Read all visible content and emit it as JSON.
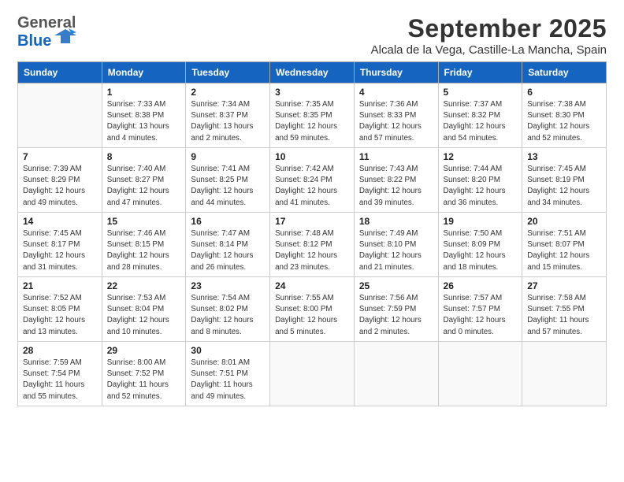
{
  "header": {
    "logo_line1": "General",
    "logo_line2": "Blue",
    "month": "September 2025",
    "location": "Alcala de la Vega, Castille-La Mancha, Spain"
  },
  "days_of_week": [
    "Sunday",
    "Monday",
    "Tuesday",
    "Wednesday",
    "Thursday",
    "Friday",
    "Saturday"
  ],
  "weeks": [
    [
      {
        "day": "",
        "info": ""
      },
      {
        "day": "1",
        "info": "Sunrise: 7:33 AM\nSunset: 8:38 PM\nDaylight: 13 hours\nand 4 minutes."
      },
      {
        "day": "2",
        "info": "Sunrise: 7:34 AM\nSunset: 8:37 PM\nDaylight: 13 hours\nand 2 minutes."
      },
      {
        "day": "3",
        "info": "Sunrise: 7:35 AM\nSunset: 8:35 PM\nDaylight: 12 hours\nand 59 minutes."
      },
      {
        "day": "4",
        "info": "Sunrise: 7:36 AM\nSunset: 8:33 PM\nDaylight: 12 hours\nand 57 minutes."
      },
      {
        "day": "5",
        "info": "Sunrise: 7:37 AM\nSunset: 8:32 PM\nDaylight: 12 hours\nand 54 minutes."
      },
      {
        "day": "6",
        "info": "Sunrise: 7:38 AM\nSunset: 8:30 PM\nDaylight: 12 hours\nand 52 minutes."
      }
    ],
    [
      {
        "day": "7",
        "info": "Sunrise: 7:39 AM\nSunset: 8:29 PM\nDaylight: 12 hours\nand 49 minutes."
      },
      {
        "day": "8",
        "info": "Sunrise: 7:40 AM\nSunset: 8:27 PM\nDaylight: 12 hours\nand 47 minutes."
      },
      {
        "day": "9",
        "info": "Sunrise: 7:41 AM\nSunset: 8:25 PM\nDaylight: 12 hours\nand 44 minutes."
      },
      {
        "day": "10",
        "info": "Sunrise: 7:42 AM\nSunset: 8:24 PM\nDaylight: 12 hours\nand 41 minutes."
      },
      {
        "day": "11",
        "info": "Sunrise: 7:43 AM\nSunset: 8:22 PM\nDaylight: 12 hours\nand 39 minutes."
      },
      {
        "day": "12",
        "info": "Sunrise: 7:44 AM\nSunset: 8:20 PM\nDaylight: 12 hours\nand 36 minutes."
      },
      {
        "day": "13",
        "info": "Sunrise: 7:45 AM\nSunset: 8:19 PM\nDaylight: 12 hours\nand 34 minutes."
      }
    ],
    [
      {
        "day": "14",
        "info": "Sunrise: 7:45 AM\nSunset: 8:17 PM\nDaylight: 12 hours\nand 31 minutes."
      },
      {
        "day": "15",
        "info": "Sunrise: 7:46 AM\nSunset: 8:15 PM\nDaylight: 12 hours\nand 28 minutes."
      },
      {
        "day": "16",
        "info": "Sunrise: 7:47 AM\nSunset: 8:14 PM\nDaylight: 12 hours\nand 26 minutes."
      },
      {
        "day": "17",
        "info": "Sunrise: 7:48 AM\nSunset: 8:12 PM\nDaylight: 12 hours\nand 23 minutes."
      },
      {
        "day": "18",
        "info": "Sunrise: 7:49 AM\nSunset: 8:10 PM\nDaylight: 12 hours\nand 21 minutes."
      },
      {
        "day": "19",
        "info": "Sunrise: 7:50 AM\nSunset: 8:09 PM\nDaylight: 12 hours\nand 18 minutes."
      },
      {
        "day": "20",
        "info": "Sunrise: 7:51 AM\nSunset: 8:07 PM\nDaylight: 12 hours\nand 15 minutes."
      }
    ],
    [
      {
        "day": "21",
        "info": "Sunrise: 7:52 AM\nSunset: 8:05 PM\nDaylight: 12 hours\nand 13 minutes."
      },
      {
        "day": "22",
        "info": "Sunrise: 7:53 AM\nSunset: 8:04 PM\nDaylight: 12 hours\nand 10 minutes."
      },
      {
        "day": "23",
        "info": "Sunrise: 7:54 AM\nSunset: 8:02 PM\nDaylight: 12 hours\nand 8 minutes."
      },
      {
        "day": "24",
        "info": "Sunrise: 7:55 AM\nSunset: 8:00 PM\nDaylight: 12 hours\nand 5 minutes."
      },
      {
        "day": "25",
        "info": "Sunrise: 7:56 AM\nSunset: 7:59 PM\nDaylight: 12 hours\nand 2 minutes."
      },
      {
        "day": "26",
        "info": "Sunrise: 7:57 AM\nSunset: 7:57 PM\nDaylight: 12 hours\nand 0 minutes."
      },
      {
        "day": "27",
        "info": "Sunrise: 7:58 AM\nSunset: 7:55 PM\nDaylight: 11 hours\nand 57 minutes."
      }
    ],
    [
      {
        "day": "28",
        "info": "Sunrise: 7:59 AM\nSunset: 7:54 PM\nDaylight: 11 hours\nand 55 minutes."
      },
      {
        "day": "29",
        "info": "Sunrise: 8:00 AM\nSunset: 7:52 PM\nDaylight: 11 hours\nand 52 minutes."
      },
      {
        "day": "30",
        "info": "Sunrise: 8:01 AM\nSunset: 7:51 PM\nDaylight: 11 hours\nand 49 minutes."
      },
      {
        "day": "",
        "info": ""
      },
      {
        "day": "",
        "info": ""
      },
      {
        "day": "",
        "info": ""
      },
      {
        "day": "",
        "info": ""
      }
    ]
  ]
}
